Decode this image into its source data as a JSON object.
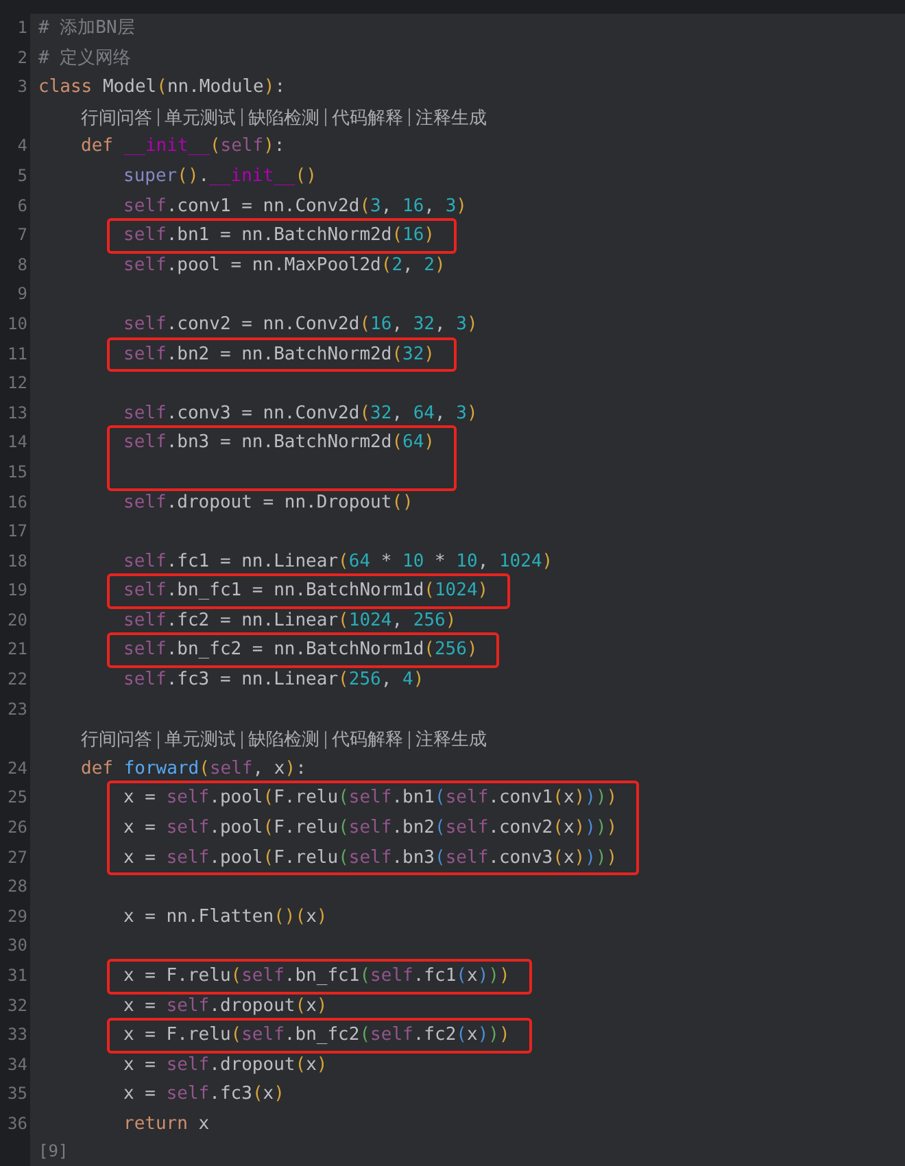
{
  "lines": [
    {
      "kind": "code",
      "number": "1",
      "tokens": [
        {
          "kind": "cm",
          "text": "# 添加BN层"
        }
      ]
    },
    {
      "kind": "code",
      "number": "2",
      "tokens": [
        {
          "kind": "cm",
          "text": "# 定义网络"
        }
      ]
    },
    {
      "kind": "code",
      "number": "3",
      "tokens": [
        {
          "kind": "kw",
          "text": "class"
        },
        {
          "kind": "tx",
          "text": " Model"
        },
        {
          "kind": "p1",
          "text": "("
        },
        {
          "kind": "tx",
          "text": "nn.Module"
        },
        {
          "kind": "p1",
          "text": ")"
        },
        {
          "kind": "tx",
          "text": ":"
        }
      ],
      "children": [
        {
          "kind": "lens",
          "links": [
            "行间问答",
            "单元测试",
            "缺陷检测",
            "代码解释",
            "注释生成"
          ]
        },
        {
          "kind": "code",
          "number": "4",
          "tokens": [
            {
              "kind": "kw",
              "text": "def "
            },
            {
              "kind": "dn",
              "text": "__init__"
            },
            {
              "kind": "p1",
              "text": "("
            },
            {
              "kind": "self",
              "text": "self"
            },
            {
              "kind": "p1",
              "text": ")"
            },
            {
              "kind": "tx",
              "text": ":"
            }
          ],
          "children": [
            {
              "kind": "code",
              "number": "5",
              "tokens": [
                {
                  "kind": "bi",
                  "text": "super"
                },
                {
                  "kind": "p1",
                  "text": "()"
                },
                {
                  "kind": "tx",
                  "text": "."
                },
                {
                  "kind": "dn",
                  "text": "__init__"
                },
                {
                  "kind": "p1",
                  "text": "()"
                }
              ]
            },
            {
              "kind": "code",
              "number": "6",
              "tokens": [
                {
                  "kind": "self",
                  "text": "self"
                },
                {
                  "kind": "tx",
                  "text": ".conv1 = nn.Conv2d"
                },
                {
                  "kind": "p1",
                  "text": "("
                },
                {
                  "kind": "num",
                  "text": "3"
                },
                {
                  "kind": "tx",
                  "text": ", "
                },
                {
                  "kind": "num",
                  "text": "16"
                },
                {
                  "kind": "tx",
                  "text": ", "
                },
                {
                  "kind": "num",
                  "text": "3"
                },
                {
                  "kind": "p1",
                  "text": ")"
                }
              ]
            },
            {
              "kind": "code",
              "number": "7",
              "boxed": true,
              "tokens": [
                {
                  "kind": "self",
                  "text": "self"
                },
                {
                  "kind": "tx",
                  "text": ".bn1 = nn.BatchNorm2d"
                },
                {
                  "kind": "p1",
                  "text": "("
                },
                {
                  "kind": "num",
                  "text": "16"
                },
                {
                  "kind": "p1",
                  "text": ")"
                }
              ]
            },
            {
              "kind": "code",
              "number": "8",
              "tokens": [
                {
                  "kind": "self",
                  "text": "self"
                },
                {
                  "kind": "tx",
                  "text": ".pool = nn.MaxPool2d"
                },
                {
                  "kind": "p1",
                  "text": "("
                },
                {
                  "kind": "num",
                  "text": "2"
                },
                {
                  "kind": "tx",
                  "text": ", "
                },
                {
                  "kind": "num",
                  "text": "2"
                },
                {
                  "kind": "p1",
                  "text": ")"
                }
              ]
            },
            {
              "kind": "code",
              "number": "9"
            },
            {
              "kind": "code",
              "number": "10",
              "tokens": [
                {
                  "kind": "self",
                  "text": "self"
                },
                {
                  "kind": "tx",
                  "text": ".conv2 = nn.Conv2d"
                },
                {
                  "kind": "p1",
                  "text": "("
                },
                {
                  "kind": "num",
                  "text": "16"
                },
                {
                  "kind": "tx",
                  "text": ", "
                },
                {
                  "kind": "num",
                  "text": "32"
                },
                {
                  "kind": "tx",
                  "text": ", "
                },
                {
                  "kind": "num",
                  "text": "3"
                },
                {
                  "kind": "p1",
                  "text": ")"
                }
              ]
            },
            {
              "kind": "code",
              "number": "11",
              "boxed": true,
              "tokens": [
                {
                  "kind": "self",
                  "text": "self"
                },
                {
                  "kind": "tx",
                  "text": ".bn2 = nn.BatchNorm2d"
                },
                {
                  "kind": "p1",
                  "text": "("
                },
                {
                  "kind": "num",
                  "text": "32"
                },
                {
                  "kind": "p1",
                  "text": ")"
                }
              ]
            },
            {
              "kind": "code",
              "number": "12"
            },
            {
              "kind": "code",
              "number": "13",
              "tokens": [
                {
                  "kind": "self",
                  "text": "self"
                },
                {
                  "kind": "tx",
                  "text": ".conv3 = nn.Conv2d"
                },
                {
                  "kind": "p1",
                  "text": "("
                },
                {
                  "kind": "num",
                  "text": "32"
                },
                {
                  "kind": "tx",
                  "text": ", "
                },
                {
                  "kind": "num",
                  "text": "64"
                },
                {
                  "kind": "tx",
                  "text": ", "
                },
                {
                  "kind": "num",
                  "text": "3"
                },
                {
                  "kind": "p1",
                  "text": ")"
                }
              ]
            },
            {
              "kind": "code",
              "number": "14",
              "boxed": true,
              "tokens": [
                {
                  "kind": "self",
                  "text": "self"
                },
                {
                  "kind": "tx",
                  "text": ".bn3 = nn.BatchNorm2d"
                },
                {
                  "kind": "p1",
                  "text": "("
                },
                {
                  "kind": "num",
                  "text": "64"
                },
                {
                  "kind": "p1",
                  "text": ")"
                }
              ]
            },
            {
              "kind": "code",
              "number": "15",
              "boxed": true
            },
            {
              "kind": "code",
              "number": "16",
              "tokens": [
                {
                  "kind": "self",
                  "text": "self"
                },
                {
                  "kind": "tx",
                  "text": ".dropout = nn.Dropout"
                },
                {
                  "kind": "p1",
                  "text": "()"
                }
              ]
            },
            {
              "kind": "code",
              "number": "17"
            },
            {
              "kind": "code",
              "number": "18",
              "tokens": [
                {
                  "kind": "self",
                  "text": "self"
                },
                {
                  "kind": "tx",
                  "text": ".fc1 = nn.Linear"
                },
                {
                  "kind": "p1",
                  "text": "("
                },
                {
                  "kind": "num",
                  "text": "64"
                },
                {
                  "kind": "tx",
                  "text": " * "
                },
                {
                  "kind": "num",
                  "text": "10"
                },
                {
                  "kind": "tx",
                  "text": " * "
                },
                {
                  "kind": "num",
                  "text": "10"
                },
                {
                  "kind": "tx",
                  "text": ", "
                },
                {
                  "kind": "num",
                  "text": "1024"
                },
                {
                  "kind": "p1",
                  "text": ")"
                }
              ]
            },
            {
              "kind": "code",
              "number": "19",
              "boxed": true,
              "tokens": [
                {
                  "kind": "self",
                  "text": "self"
                },
                {
                  "kind": "tx",
                  "text": ".bn_fc1 = nn.BatchNorm1d"
                },
                {
                  "kind": "p1",
                  "text": "("
                },
                {
                  "kind": "num",
                  "text": "1024"
                },
                {
                  "kind": "p1",
                  "text": ")"
                }
              ]
            },
            {
              "kind": "code",
              "number": "20",
              "tokens": [
                {
                  "kind": "self",
                  "text": "self"
                },
                {
                  "kind": "tx",
                  "text": ".fc2 = nn.Linear"
                },
                {
                  "kind": "p1",
                  "text": "("
                },
                {
                  "kind": "num",
                  "text": "1024"
                },
                {
                  "kind": "tx",
                  "text": ", "
                },
                {
                  "kind": "num",
                  "text": "256"
                },
                {
                  "kind": "p1",
                  "text": ")"
                }
              ]
            },
            {
              "kind": "code",
              "number": "21",
              "boxed": true,
              "tokens": [
                {
                  "kind": "self",
                  "text": "self"
                },
                {
                  "kind": "tx",
                  "text": ".bn_fc2 = nn.BatchNorm1d"
                },
                {
                  "kind": "p1",
                  "text": "("
                },
                {
                  "kind": "num",
                  "text": "256"
                },
                {
                  "kind": "p1",
                  "text": ")"
                }
              ]
            },
            {
              "kind": "code",
              "number": "22",
              "tokens": [
                {
                  "kind": "self",
                  "text": "self"
                },
                {
                  "kind": "tx",
                  "text": ".fc3 = nn.Linear"
                },
                {
                  "kind": "p1",
                  "text": "("
                },
                {
                  "kind": "num",
                  "text": "256"
                },
                {
                  "kind": "tx",
                  "text": ", "
                },
                {
                  "kind": "num",
                  "text": "4"
                },
                {
                  "kind": "p1",
                  "text": ")"
                }
              ]
            },
            {
              "kind": "code",
              "number": "23"
            }
          ]
        },
        {
          "kind": "lens",
          "links": [
            "行间问答",
            "单元测试",
            "缺陷检测",
            "代码解释",
            "注释生成"
          ]
        },
        {
          "kind": "code",
          "number": "24",
          "tokens": [
            {
              "kind": "kw",
              "text": "def "
            },
            {
              "kind": "fn",
              "text": "forward"
            },
            {
              "kind": "p1",
              "text": "("
            },
            {
              "kind": "self",
              "text": "self"
            },
            {
              "kind": "tx",
              "text": ", x"
            },
            {
              "kind": "p1",
              "text": ")"
            },
            {
              "kind": "tx",
              "text": ":"
            }
          ],
          "children": [
            {
              "kind": "code",
              "number": "25",
              "boxed": true,
              "tokens": [
                {
                  "kind": "tx",
                  "text": "x = "
                },
                {
                  "kind": "self",
                  "text": "self"
                },
                {
                  "kind": "tx",
                  "text": ".pool"
                },
                {
                  "kind": "p1",
                  "text": "("
                },
                {
                  "kind": "tx",
                  "text": "F.relu"
                },
                {
                  "kind": "p2",
                  "text": "("
                },
                {
                  "kind": "self",
                  "text": "self"
                },
                {
                  "kind": "tx",
                  "text": ".bn1"
                },
                {
                  "kind": "p3",
                  "text": "("
                },
                {
                  "kind": "self",
                  "text": "self"
                },
                {
                  "kind": "tx",
                  "text": ".conv1"
                },
                {
                  "kind": "p1",
                  "text": "("
                },
                {
                  "kind": "tx",
                  "text": "x"
                },
                {
                  "kind": "p1",
                  "text": ")"
                },
                {
                  "kind": "p3",
                  "text": ")"
                },
                {
                  "kind": "p2",
                  "text": ")"
                },
                {
                  "kind": "p1",
                  "text": ")"
                }
              ]
            },
            {
              "kind": "code",
              "number": "26",
              "boxed": true,
              "tokens": [
                {
                  "kind": "tx",
                  "text": "x = "
                },
                {
                  "kind": "self",
                  "text": "self"
                },
                {
                  "kind": "tx",
                  "text": ".pool"
                },
                {
                  "kind": "p1",
                  "text": "("
                },
                {
                  "kind": "tx",
                  "text": "F.relu"
                },
                {
                  "kind": "p2",
                  "text": "("
                },
                {
                  "kind": "self",
                  "text": "self"
                },
                {
                  "kind": "tx",
                  "text": ".bn2"
                },
                {
                  "kind": "p3",
                  "text": "("
                },
                {
                  "kind": "self",
                  "text": "self"
                },
                {
                  "kind": "tx",
                  "text": ".conv2"
                },
                {
                  "kind": "p1",
                  "text": "("
                },
                {
                  "kind": "tx",
                  "text": "x"
                },
                {
                  "kind": "p1",
                  "text": ")"
                },
                {
                  "kind": "p3",
                  "text": ")"
                },
                {
                  "kind": "p2",
                  "text": ")"
                },
                {
                  "kind": "p1",
                  "text": ")"
                }
              ]
            },
            {
              "kind": "code",
              "number": "27",
              "boxed": true,
              "tokens": [
                {
                  "kind": "tx",
                  "text": "x = "
                },
                {
                  "kind": "self",
                  "text": "self"
                },
                {
                  "kind": "tx",
                  "text": ".pool"
                },
                {
                  "kind": "p1",
                  "text": "("
                },
                {
                  "kind": "tx",
                  "text": "F.relu"
                },
                {
                  "kind": "p2",
                  "text": "("
                },
                {
                  "kind": "self",
                  "text": "self"
                },
                {
                  "kind": "tx",
                  "text": ".bn3"
                },
                {
                  "kind": "p3",
                  "text": "("
                },
                {
                  "kind": "self",
                  "text": "self"
                },
                {
                  "kind": "tx",
                  "text": ".conv3"
                },
                {
                  "kind": "p1",
                  "text": "("
                },
                {
                  "kind": "tx",
                  "text": "x"
                },
                {
                  "kind": "p1",
                  "text": ")"
                },
                {
                  "kind": "p3",
                  "text": ")"
                },
                {
                  "kind": "p2",
                  "text": ")"
                },
                {
                  "kind": "p1",
                  "text": ")"
                }
              ]
            },
            {
              "kind": "code",
              "number": "28"
            },
            {
              "kind": "code",
              "number": "29",
              "tokens": [
                {
                  "kind": "tx",
                  "text": "x = nn.Flatten"
                },
                {
                  "kind": "p1",
                  "text": "()("
                },
                {
                  "kind": "tx",
                  "text": "x"
                },
                {
                  "kind": "p1",
                  "text": ")"
                }
              ]
            },
            {
              "kind": "code",
              "number": "30"
            },
            {
              "kind": "code",
              "number": "31",
              "boxed": true,
              "tokens": [
                {
                  "kind": "tx",
                  "text": "x = F.relu"
                },
                {
                  "kind": "p1",
                  "text": "("
                },
                {
                  "kind": "self",
                  "text": "self"
                },
                {
                  "kind": "tx",
                  "text": ".bn_fc1"
                },
                {
                  "kind": "p2",
                  "text": "("
                },
                {
                  "kind": "self",
                  "text": "self"
                },
                {
                  "kind": "tx",
                  "text": ".fc1"
                },
                {
                  "kind": "p3",
                  "text": "("
                },
                {
                  "kind": "tx",
                  "text": "x"
                },
                {
                  "kind": "p3",
                  "text": ")"
                },
                {
                  "kind": "p2",
                  "text": ")"
                },
                {
                  "kind": "p1",
                  "text": ")"
                }
              ]
            },
            {
              "kind": "code",
              "number": "32",
              "tokens": [
                {
                  "kind": "tx",
                  "text": "x = "
                },
                {
                  "kind": "self",
                  "text": "self"
                },
                {
                  "kind": "tx",
                  "text": ".dropout"
                },
                {
                  "kind": "p1",
                  "text": "("
                },
                {
                  "kind": "tx",
                  "text": "x"
                },
                {
                  "kind": "p1",
                  "text": ")"
                }
              ]
            },
            {
              "kind": "code",
              "number": "33",
              "boxed": true,
              "tokens": [
                {
                  "kind": "tx",
                  "text": "x = F.relu"
                },
                {
                  "kind": "p1",
                  "text": "("
                },
                {
                  "kind": "self",
                  "text": "self"
                },
                {
                  "kind": "tx",
                  "text": ".bn_fc2"
                },
                {
                  "kind": "p2",
                  "text": "("
                },
                {
                  "kind": "self",
                  "text": "self"
                },
                {
                  "kind": "tx",
                  "text": ".fc2"
                },
                {
                  "kind": "p3",
                  "text": "("
                },
                {
                  "kind": "tx",
                  "text": "x"
                },
                {
                  "kind": "p3",
                  "text": ")"
                },
                {
                  "kind": "p2",
                  "text": ")"
                },
                {
                  "kind": "p1",
                  "text": ")"
                }
              ]
            },
            {
              "kind": "code",
              "number": "34",
              "tokens": [
                {
                  "kind": "tx",
                  "text": "x = "
                },
                {
                  "kind": "self",
                  "text": "self"
                },
                {
                  "kind": "tx",
                  "text": ".dropout"
                },
                {
                  "kind": "p1",
                  "text": "("
                },
                {
                  "kind": "tx",
                  "text": "x"
                },
                {
                  "kind": "p1",
                  "text": ")"
                }
              ]
            },
            {
              "kind": "code",
              "number": "35",
              "tokens": [
                {
                  "kind": "tx",
                  "text": "x = "
                },
                {
                  "kind": "self",
                  "text": "self"
                },
                {
                  "kind": "tx",
                  "text": ".fc3"
                },
                {
                  "kind": "p1",
                  "text": "("
                },
                {
                  "kind": "tx",
                  "text": "x"
                },
                {
                  "kind": "p1",
                  "text": ")"
                }
              ]
            },
            {
              "kind": "code",
              "number": "36",
              "tokens": [
                {
                  "kind": "kw",
                  "text": "return"
                },
                {
                  "kind": "tx",
                  "text": " x"
                }
              ]
            }
          ]
        }
      ]
    }
  ],
  "cell_label": "[9]"
}
